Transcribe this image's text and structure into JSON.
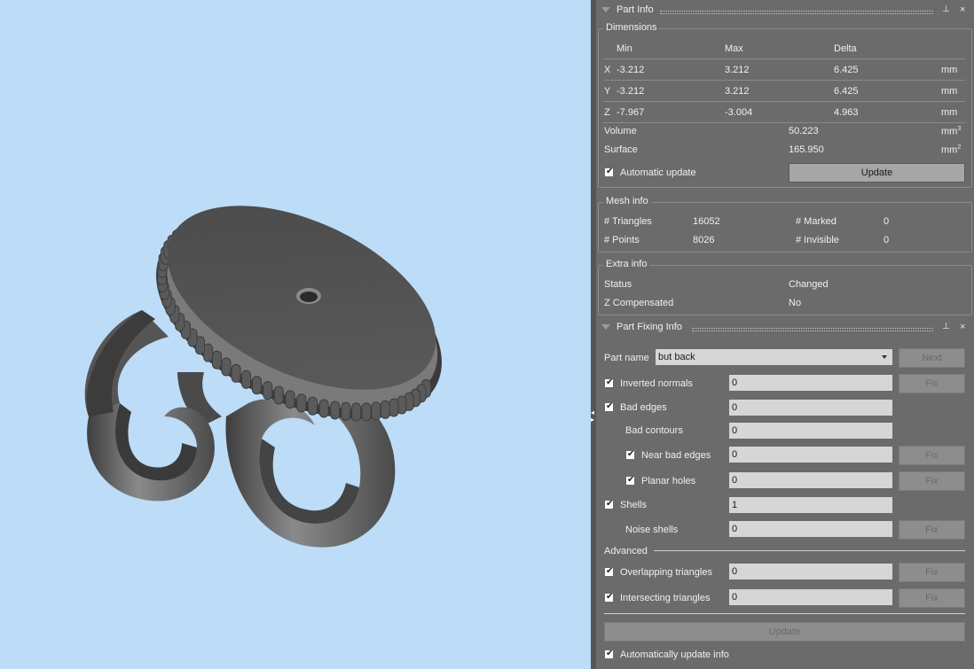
{
  "part_info": {
    "title": "Part Info",
    "dimensions": {
      "legend": "Dimensions",
      "headers": {
        "min": "Min",
        "max": "Max",
        "delta": "Delta"
      },
      "rows": [
        {
          "axis": "X",
          "min": "-3.212",
          "max": "3.212",
          "delta": "6.425",
          "unit": "mm"
        },
        {
          "axis": "Y",
          "min": "-3.212",
          "max": "3.212",
          "delta": "6.425",
          "unit": "mm"
        },
        {
          "axis": "Z",
          "min": "-7.967",
          "max": "-3.004",
          "delta": "4.963",
          "unit": "mm"
        }
      ],
      "volume_label": "Volume",
      "volume_value": "50.223",
      "volume_unit": "mm",
      "volume_exp": "3",
      "surface_label": "Surface",
      "surface_value": "165.950",
      "surface_unit": "mm",
      "surface_exp": "2",
      "auto_update_label": "Automatic update",
      "update_button": "Update"
    },
    "mesh_info": {
      "legend": "Mesh info",
      "triangles_label": "# Triangles",
      "triangles_value": "16052",
      "marked_label": "# Marked",
      "marked_value": "0",
      "points_label": "# Points",
      "points_value": "8026",
      "invisible_label": "# Invisible",
      "invisible_value": "0"
    },
    "extra_info": {
      "legend": "Extra info",
      "status_label": "Status",
      "status_value": "Changed",
      "zcomp_label": "Z Compensated",
      "zcomp_value": "No"
    }
  },
  "part_fixing": {
    "title": "Part Fixing Info",
    "part_name_label": "Part name",
    "part_name_value": "but back",
    "next_button": "Next",
    "fix_label": "Fix",
    "rows": {
      "inverted_normals": {
        "label": "Inverted normals",
        "value": "0"
      },
      "bad_edges": {
        "label": "Bad edges",
        "value": "0"
      },
      "bad_contours": {
        "label": "Bad contours",
        "value": "0"
      },
      "near_bad_edges": {
        "label": "Near bad edges",
        "value": "0"
      },
      "planar_holes": {
        "label": "Planar holes",
        "value": "0"
      },
      "shells": {
        "label": "Shells",
        "value": "1"
      },
      "noise_shells": {
        "label": "Noise shells",
        "value": "0"
      },
      "overlapping": {
        "label": "Overlapping triangles",
        "value": "0"
      },
      "intersecting": {
        "label": "Intersecting triangles",
        "value": "0"
      }
    },
    "advanced_label": "Advanced",
    "update_button": "Update",
    "auto_update_label": "Automatically update info"
  },
  "colors": {
    "viewport_bg": "#bcdcf7",
    "panel_bg": "#6b6b6b",
    "model": "#6e6e6e"
  }
}
